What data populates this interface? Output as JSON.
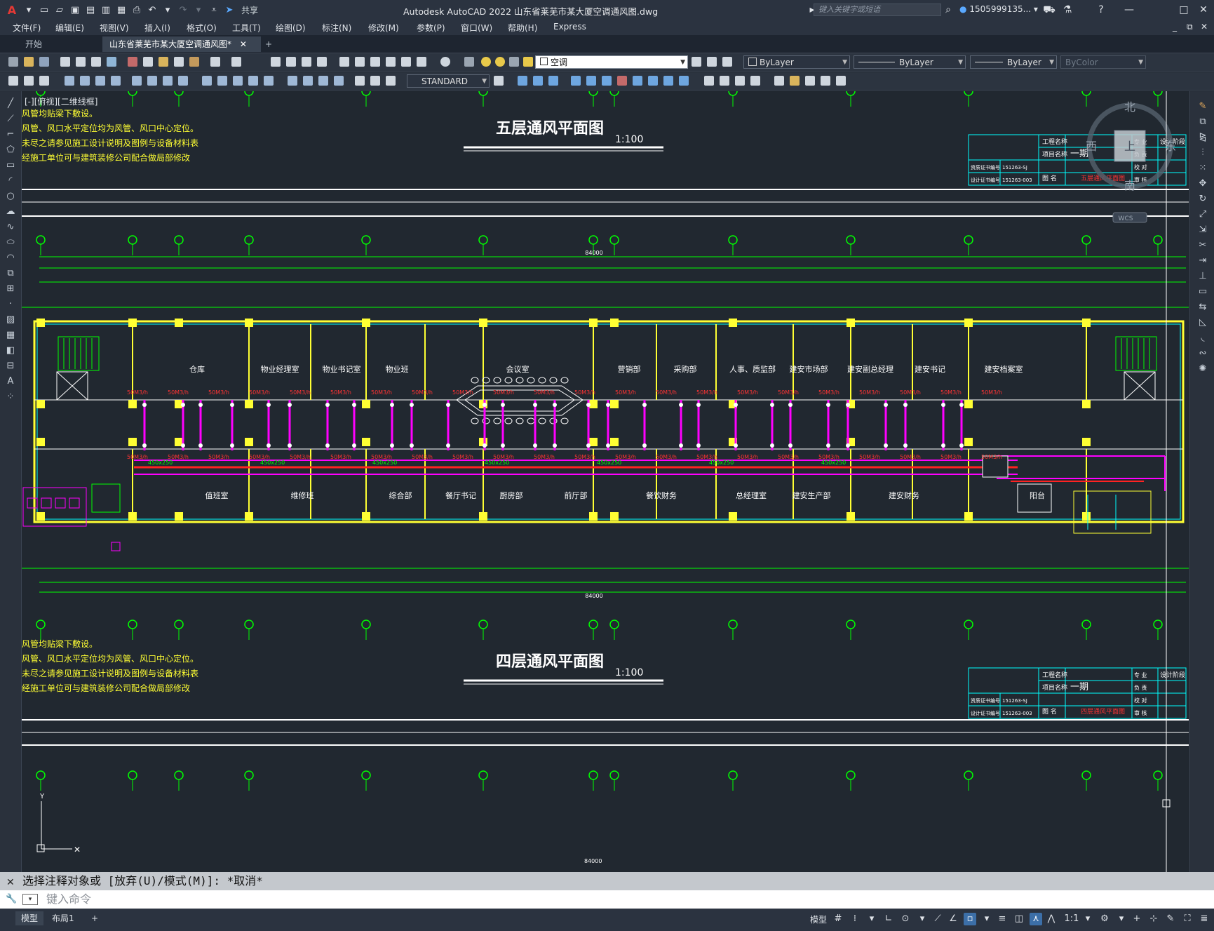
{
  "app": {
    "title": "Autodesk AutoCAD 2022    山东省莱芜市某大厦空调通风图.dwg",
    "share_label": "共享",
    "search_placeholder": "键入关键字或短语",
    "user": "1505999135...",
    "logo_letter": "A"
  },
  "menu": [
    "文件(F)",
    "编辑(E)",
    "视图(V)",
    "插入(I)",
    "格式(O)",
    "工具(T)",
    "绘图(D)",
    "标注(N)",
    "修改(M)",
    "参数(P)",
    "窗口(W)",
    "帮助(H)",
    "Express"
  ],
  "tabs": {
    "start": "开始",
    "document": "山东省莱芜市某大厦空调通风图*",
    "add": "+"
  },
  "toolbar": {
    "layer": "空调",
    "color": "ByLayer",
    "linetype": "ByLayer",
    "lineweight": "ByLayer",
    "plotstyle": "ByColor",
    "textstyle": "STANDARD"
  },
  "viewport": {
    "view_label": "[-][俯视][二维线框]"
  },
  "viewcube": {
    "north": "北",
    "south": "南",
    "east": "东",
    "west": "西",
    "top": "上",
    "wcs": "WCS"
  },
  "drawing": {
    "title_5": "五层通风平面图",
    "title_4": "四层通风平面图",
    "scale": "1:100",
    "notes": [
      "风管均贴梁下敷设。",
      "风管、风口水平定位均为风管、风口中心定位。",
      "未尽之请参见施工设计说明及图例与设备材料表",
      "经施工单位可与建筑装修公司配合做局部修改"
    ],
    "total_dim": "84000",
    "rooms_top": [
      "仓库",
      "物业经理室",
      "物业书记室",
      "物业班",
      "会议室",
      "营销部",
      "采购部",
      "人事、质监部",
      "建安市场部",
      "建安副总经理",
      "建安书记",
      "建安档案室"
    ],
    "rooms_bottom": [
      "值班室",
      "维修班",
      "综合部",
      "餐厅书记",
      "厨房部",
      "前厅部",
      "餐饮财务",
      "总经理室",
      "建安生产部",
      "建安财务",
      "阳台"
    ],
    "airflow": "50M3/h",
    "duct": "450x250",
    "title_block": {
      "project_label": "工程名称",
      "item_label": "项目名称",
      "phase": "一期",
      "drawing_label": "图 名",
      "drawing_name_5": "五层通风平面图",
      "drawing_name_4": "四层通风平面图",
      "code1": "151263-SJ",
      "code2": "151263-003",
      "code1_label": "资质证书编号",
      "code2_label": "设计证书编号",
      "stage_label": "设计阶段",
      "roles": [
        "专 业",
        "负 责",
        "校 对",
        "审 核"
      ]
    }
  },
  "command": {
    "history": "选择注释对象或 [放弃(U)/模式(M)]: *取消*",
    "placeholder": "键入命令"
  },
  "status": {
    "layout_tabs": [
      "模型",
      "布局1"
    ],
    "add": "+",
    "model": "模型",
    "scale": "1:1"
  }
}
